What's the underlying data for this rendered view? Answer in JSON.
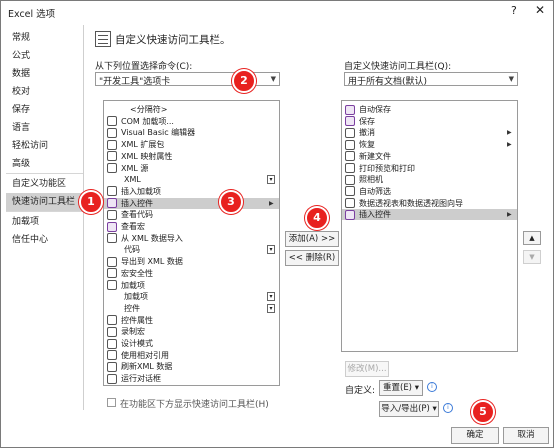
{
  "window": {
    "title": "Excel 选项",
    "help": "?",
    "close": "✕"
  },
  "sidebar": {
    "items": [
      {
        "label": "常规"
      },
      {
        "label": "公式"
      },
      {
        "label": "数据"
      },
      {
        "label": "校对"
      },
      {
        "label": "保存"
      },
      {
        "label": "语言"
      },
      {
        "label": "轻松访问"
      },
      {
        "label": "高级"
      },
      {
        "label": "自定义功能区"
      },
      {
        "label": "快速访问工具栏"
      },
      {
        "label": "加载项"
      },
      {
        "label": "信任中心"
      }
    ],
    "selected": "快速访问工具栏"
  },
  "header": {
    "title": "自定义快速访问工具栏。",
    "icon": "qat-customize-icon"
  },
  "left": {
    "choose_label": "从下列位置选择命令(C):",
    "choose_value": "\"开发工具\"选项卡",
    "items": [
      {
        "label": "<分隔符>",
        "icon": "none"
      },
      {
        "label": "COM 加载项...",
        "icon": "com-addin-icon"
      },
      {
        "label": "Visual Basic 编辑器",
        "icon": "vb-editor-icon"
      },
      {
        "label": "XML 扩展包",
        "icon": "xml-pack-icon"
      },
      {
        "label": "XML 映射属性",
        "icon": "xml-map-icon"
      },
      {
        "label": "XML 源",
        "icon": "xml-source-icon"
      },
      {
        "label": "XML",
        "icon": "none",
        "box": true
      },
      {
        "label": "插入加载项",
        "icon": "insert-addin-icon"
      },
      {
        "label": "插入控件",
        "icon": "insert-control-icon",
        "selected": true,
        "arrow": true
      },
      {
        "label": "查看代码",
        "icon": "view-code-icon"
      },
      {
        "label": "查看宏",
        "icon": "view-macro-icon"
      },
      {
        "label": "从 XML 数据导入",
        "icon": "xml-import-icon"
      },
      {
        "label": "代码",
        "icon": "none",
        "box": true
      },
      {
        "label": "导出到 XML 数据",
        "icon": "xml-export-icon"
      },
      {
        "label": "宏安全性",
        "icon": "macro-security-icon"
      },
      {
        "label": "加载项",
        "icon": "addin-icon"
      },
      {
        "label": "加载项",
        "icon": "none",
        "box": true
      },
      {
        "label": "控件",
        "icon": "none",
        "box": true
      },
      {
        "label": "控件属性",
        "icon": "control-props-icon"
      },
      {
        "label": "录制宏",
        "icon": "record-macro-icon"
      },
      {
        "label": "设计模式",
        "icon": "design-mode-icon"
      },
      {
        "label": "使用相对引用",
        "icon": "relative-ref-icon"
      },
      {
        "label": "刷新XML 数据",
        "icon": "refresh-xml-icon"
      },
      {
        "label": "运行对话框",
        "icon": "run-dialog-icon"
      }
    ],
    "show_below_label": "在功能区下方显示快速访问工具栏(H)"
  },
  "right": {
    "label": "自定义快速访问工具栏(Q):",
    "value": "用于所有文档(默认)",
    "items": [
      {
        "label": "自动保存",
        "icon": "autosave-icon"
      },
      {
        "label": "保存",
        "icon": "save-icon"
      },
      {
        "label": "撤消",
        "icon": "undo-icon",
        "arrow": true
      },
      {
        "label": "恢复",
        "icon": "redo-icon",
        "arrow": true
      },
      {
        "label": "新建文件",
        "icon": "new-file-icon"
      },
      {
        "label": "打印预览和打印",
        "icon": "print-preview-icon"
      },
      {
        "label": "照相机",
        "icon": "camera-icon"
      },
      {
        "label": "自动筛选",
        "icon": "autofilter-icon"
      },
      {
        "label": "数据透视表和数据透视图向导",
        "icon": "pivot-wizard-icon"
      },
      {
        "label": "插入控件",
        "icon": "insert-control-icon",
        "selected": true,
        "arrow": true
      }
    ],
    "modify": "修改(M)...",
    "customize_label": "自定义:",
    "reset": "重置(E) ▾",
    "import_export": "导入/导出(P) ▾"
  },
  "buttons": {
    "add": "添加(A) >>",
    "remove": "<< 删除(R)",
    "ok": "确定",
    "cancel": "取消",
    "up": "▲",
    "down": "▼"
  },
  "badges": [
    "1",
    "2",
    "3",
    "4",
    "5"
  ],
  "colors": {
    "badge": "#e8211f",
    "selection": "#cdcdcd",
    "accent_purple": "#7b3fa0"
  }
}
